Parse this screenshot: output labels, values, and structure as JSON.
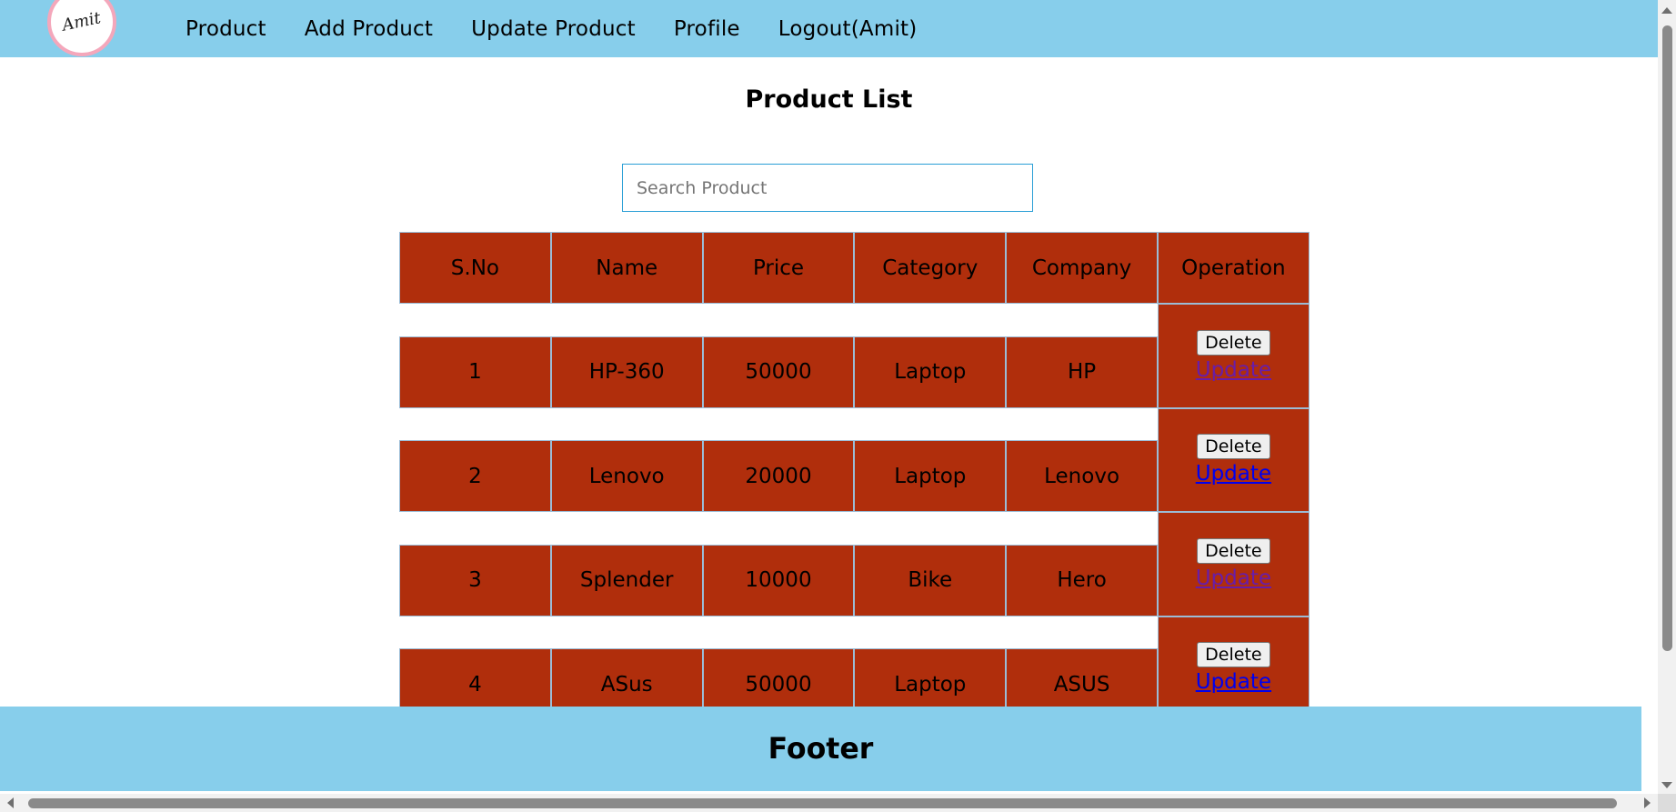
{
  "logo": {
    "text": "Amit"
  },
  "nav": {
    "items": [
      {
        "label": "Product"
      },
      {
        "label": "Add Product"
      },
      {
        "label": "Update Product"
      },
      {
        "label": "Profile"
      },
      {
        "label": "Logout(Amit)"
      }
    ]
  },
  "page": {
    "title": "Product List"
  },
  "search": {
    "placeholder": "Search Product",
    "value": ""
  },
  "table": {
    "headers": [
      "S.No",
      "Name",
      "Price",
      "Category",
      "Company",
      "Operation"
    ],
    "rows": [
      {
        "sno": "1",
        "name": "HP-360",
        "price": "50000",
        "category": "Laptop",
        "company": "HP",
        "delete_label": "Delete",
        "update_label": "Update",
        "update_visited": true
      },
      {
        "sno": "2",
        "name": "Lenovo",
        "price": "20000",
        "category": "Laptop",
        "company": "Lenovo",
        "delete_label": "Delete",
        "update_label": "Update",
        "update_visited": false
      },
      {
        "sno": "3",
        "name": "Splender",
        "price": "10000",
        "category": "Bike",
        "company": "Hero",
        "delete_label": "Delete",
        "update_label": "Update",
        "update_visited": true
      },
      {
        "sno": "4",
        "name": "ASus",
        "price": "50000",
        "category": "Laptop",
        "company": "ASUS",
        "delete_label": "Delete",
        "update_label": "Update",
        "update_visited": false
      }
    ]
  },
  "footer": {
    "text": "Footer"
  },
  "colors": {
    "nav_bg": "#87ceeb",
    "cell_bg": "#b02e0c",
    "link": "#0000ee",
    "link_visited": "#681da8"
  }
}
